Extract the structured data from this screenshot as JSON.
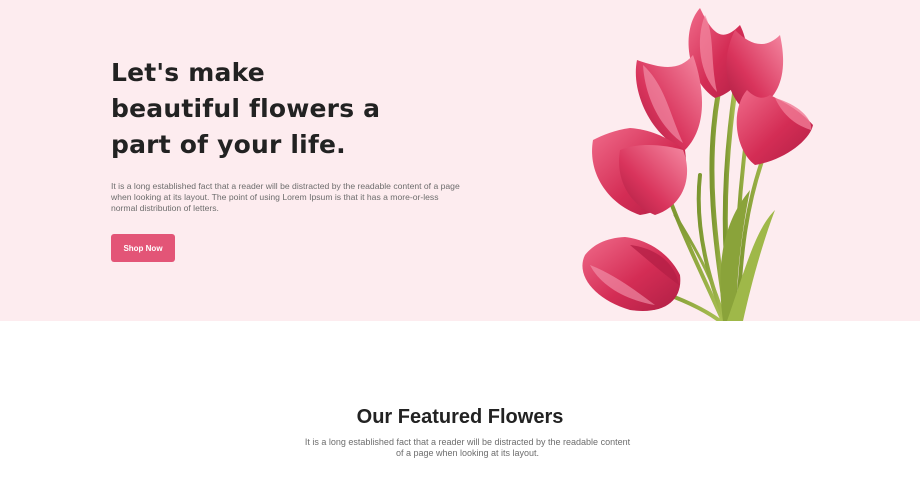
{
  "hero": {
    "title_lines": [
      "Let's make",
      "beautiful flowers a",
      "part of your life."
    ],
    "text": "It is a long established fact that a reader will be distracted by the readable content of a page when looking at its layout. The point of using Lorem Ipsum is that it has a more-or-less normal distribution of letters.",
    "button_label": "Shop Now",
    "image": "tulip-bouquet"
  },
  "featured": {
    "title": "Our Featured Flowers",
    "text": "It is a long established fact that a reader will be distracted by the readable content of a page when looking at its layout."
  },
  "colors": {
    "hero_background": "#fdecef",
    "accent": "#e35577",
    "heading": "#222222",
    "body_text": "#6d6d6d",
    "tulip": "#d6335a",
    "stem": "#8fa83a"
  }
}
